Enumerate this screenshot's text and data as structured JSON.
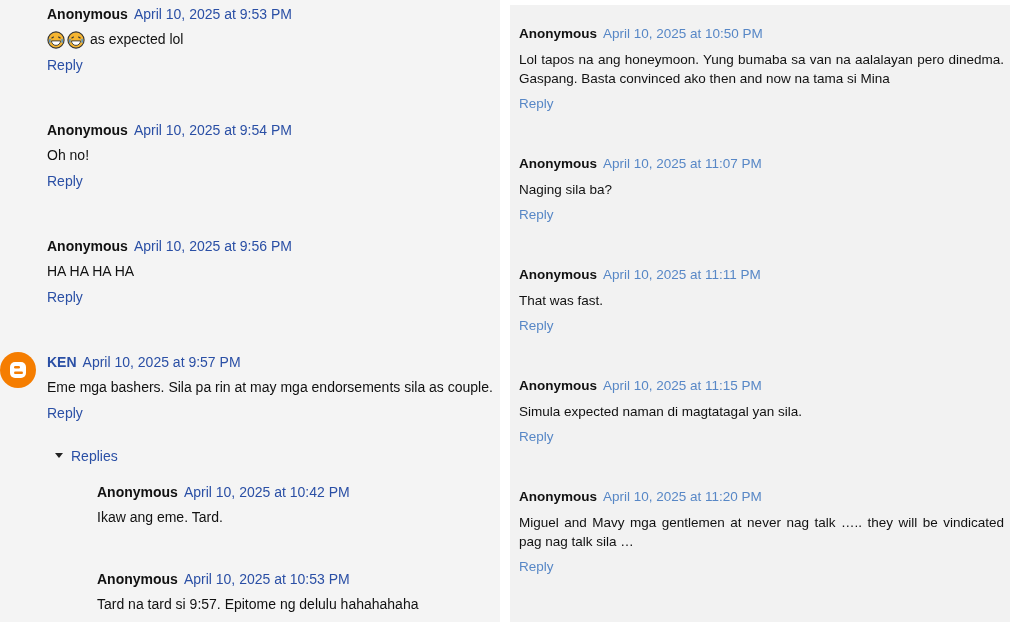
{
  "columns": [
    {
      "comments": [
        {
          "author": "Anonymous",
          "kind": "anonymous",
          "date": "April 10, 2025 at 9:53 PM",
          "leading_icons": [
            {
              "kind": "laughing-face"
            },
            {
              "kind": "laughing-face"
            }
          ],
          "text": "as expected lol",
          "reply": "Reply"
        },
        {
          "author": "Anonymous",
          "kind": "anonymous",
          "date": "April 10, 2025 at 9:54 PM",
          "text": "Oh no!",
          "reply": "Reply"
        },
        {
          "author": "Anonymous",
          "kind": "anonymous",
          "date": "April 10, 2025 at 9:56 PM",
          "text": "HA HA HA HA",
          "reply": "Reply"
        },
        {
          "author": "KEN",
          "kind": "blogger",
          "date": "April 10, 2025 at 9:57 PM",
          "text": "Eme mga bashers. Sila pa rin at may mga endorsements sila as couple.",
          "reply": "Reply",
          "replies_toggle": {
            "label": "Replies",
            "expanded": true
          },
          "children": [
            {
              "author": "Anonymous",
              "kind": "anonymous",
              "date": "April 10, 2025 at 10:42 PM",
              "text": "Ikaw ang eme. Tard."
            },
            {
              "author": "Anonymous",
              "kind": "anonymous",
              "date": "April 10, 2025 at 10:53 PM",
              "text": "Tard na tard si 9:57. Epitome ng delulu hahahahaha"
            }
          ]
        }
      ]
    },
    {
      "comments": [
        {
          "author": "Anonymous",
          "kind": "anonymous",
          "date": "April 10, 2025 at 10:50 PM",
          "text": "Lol tapos na ang honeymoon. Yung bumaba sa van na aalalayan pero dinedma. Gaspang. Basta convinced ako then and now na tama si Mina",
          "reply": "Reply"
        },
        {
          "author": "Anonymous",
          "kind": "anonymous",
          "date": "April 10, 2025 at 11:07 PM",
          "text": "Naging sila ba?",
          "reply": "Reply"
        },
        {
          "author": "Anonymous",
          "kind": "anonymous",
          "date": "April 10, 2025 at 11:11 PM",
          "text": "That was fast.",
          "reply": "Reply"
        },
        {
          "author": "Anonymous",
          "kind": "anonymous",
          "date": "April 10, 2025 at 11:15 PM",
          "text": "Simula expected naman di magtatagal yan sila.",
          "reply": "Reply"
        },
        {
          "author": "Anonymous",
          "kind": "anonymous",
          "date": "April 10, 2025 at 11:20 PM",
          "text": "Miguel and Mavy mga gentlemen at never nag talk ….. they will be vindicated pag nag talk sila …",
          "reply": "Reply"
        }
      ]
    }
  ]
}
